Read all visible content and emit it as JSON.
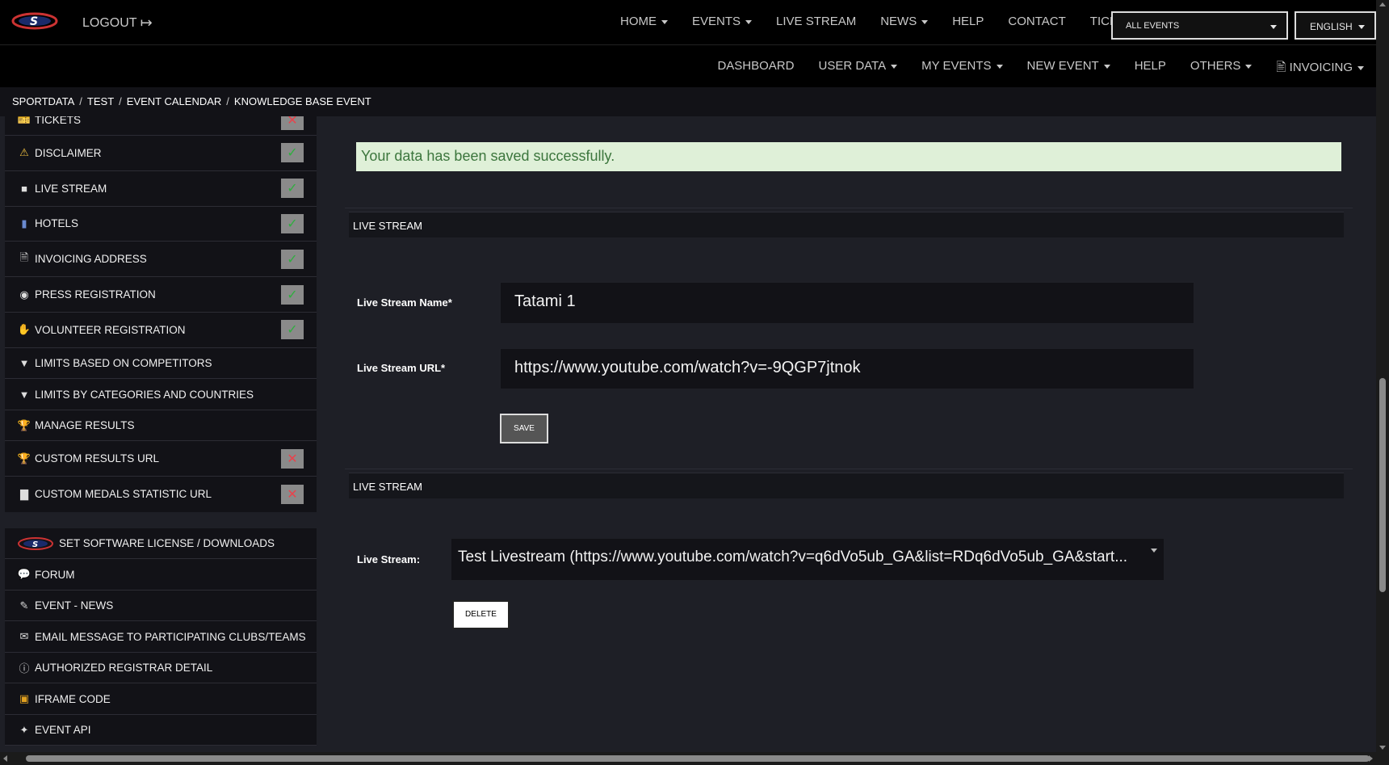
{
  "header": {
    "logout_label": "LOGOUT",
    "nav": [
      {
        "label": "HOME",
        "dropdown": true
      },
      {
        "label": "EVENTS",
        "dropdown": true
      },
      {
        "label": "LIVE STREAM",
        "dropdown": false
      },
      {
        "label": "NEWS",
        "dropdown": true
      },
      {
        "label": "HELP",
        "dropdown": false
      },
      {
        "label": "CONTACT",
        "dropdown": false
      },
      {
        "label": "TICKETS",
        "dropdown": false
      }
    ],
    "events_select": "ALL EVENTS",
    "language_select": "ENGLISH",
    "subnav": [
      {
        "label": "DASHBOARD",
        "dropdown": false
      },
      {
        "label": "USER DATA",
        "dropdown": true
      },
      {
        "label": "MY EVENTS",
        "dropdown": true
      },
      {
        "label": "NEW EVENT",
        "dropdown": true
      },
      {
        "label": "HELP",
        "dropdown": false
      },
      {
        "label": "OTHERS",
        "dropdown": true
      },
      {
        "label": "INVOICING",
        "dropdown": true
      }
    ]
  },
  "breadcrumb": [
    "SPORTDATA",
    "TEST",
    "EVENT CALENDAR",
    "KNOWLEDGE BASE EVENT"
  ],
  "sidebar": {
    "items": [
      {
        "label": "TICKETS",
        "icon": "ticket-icon",
        "status": "no"
      },
      {
        "label": "DISCLAIMER",
        "icon": "warning-icon",
        "status": "ok"
      },
      {
        "label": "LIVE STREAM",
        "icon": "video-camera-icon",
        "status": "ok"
      },
      {
        "label": "HOTELS",
        "icon": "luggage-icon",
        "status": "ok"
      },
      {
        "label": "INVOICING ADDRESS",
        "icon": "document-icon",
        "status": "ok"
      },
      {
        "label": "PRESS REGISTRATION",
        "icon": "camera-icon",
        "status": "ok"
      },
      {
        "label": "VOLUNTEER REGISTRATION",
        "icon": "hand-icon",
        "status": "ok"
      },
      {
        "label": "LIMITS BASED ON COMPETITORS",
        "icon": "filter-icon",
        "status": ""
      },
      {
        "label": "LIMITS BY CATEGORIES AND COUNTRIES",
        "icon": "filter-icon",
        "status": ""
      },
      {
        "label": "MANAGE RESULTS",
        "icon": "trophy-icon",
        "status": ""
      },
      {
        "label": "CUSTOM RESULTS URL",
        "icon": "trophy-icon",
        "status": "no"
      },
      {
        "label": "CUSTOM MEDALS STATISTIC URL",
        "icon": "bar-chart-icon",
        "status": "no"
      }
    ],
    "items2": [
      {
        "label": "SET SOFTWARE LICENSE / DOWNLOADS",
        "icon": "sportdata-logo-icon"
      },
      {
        "label": "FORUM",
        "icon": "forum-icon"
      },
      {
        "label": "EVENT - NEWS",
        "icon": "news-icon"
      },
      {
        "label": "EMAIL MESSAGE TO PARTICIPATING CLUBS/TEAMS",
        "icon": "envelope-icon"
      },
      {
        "label": "AUTHORIZED REGISTRAR DETAIL",
        "icon": "info-icon"
      },
      {
        "label": "IFRAME CODE",
        "icon": "code-icon"
      },
      {
        "label": "EVENT API",
        "icon": "puzzle-icon"
      }
    ]
  },
  "main": {
    "alert": "Your data has been saved successfully.",
    "panel1_title": "LIVE STREAM",
    "name_label": "Live Stream Name*",
    "name_value": "Tatami 1",
    "url_label": "Live Stream URL*",
    "url_value": "https://www.youtube.com/watch?v=-9QGP7jtnok",
    "save_label": "SAVE",
    "panel2_title": "LIVE STREAM",
    "stream_label": "Live Stream:",
    "stream_value": "Test Livestream (https://www.youtube.com/watch?v=q6dVo5ub_GA&list=RDq6dVo5ub_GA&start...",
    "delete_label": "DELETE"
  },
  "colors": {
    "background": "#1e1f26",
    "alert_bg": "#dff0d8",
    "alert_text": "#3c763d",
    "ok": "#2fae3f",
    "no": "#e8434c"
  }
}
